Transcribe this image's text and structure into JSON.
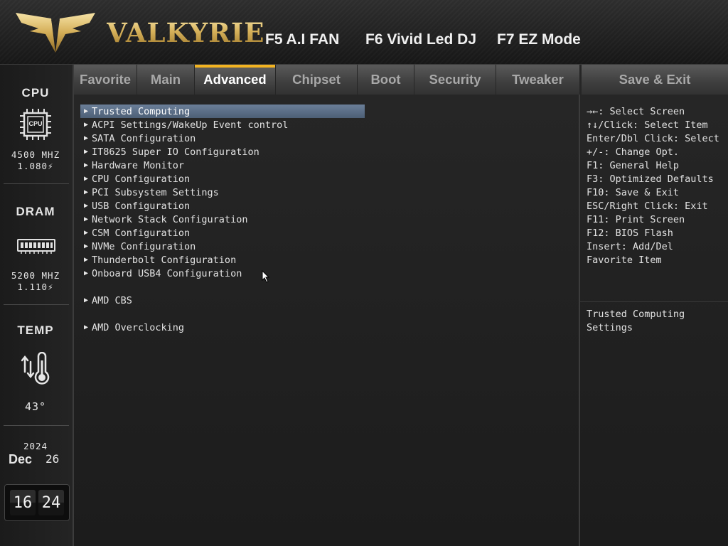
{
  "header": {
    "brand": "VALKYRIE",
    "hotkeys": {
      "fan": "F5 A.I FAN",
      "led": "F6 Vivid Led DJ",
      "ez": "F7 EZ Mode"
    }
  },
  "sidebar": {
    "cpu": {
      "label": "CPU",
      "chip_text": "CPU",
      "freq": "4500 MHZ",
      "volt": "1.080⚡"
    },
    "dram": {
      "label": "DRAM",
      "freq": "5200 MHZ",
      "volt": "1.110⚡"
    },
    "temp": {
      "label": "TEMP",
      "value": "43°"
    },
    "date": {
      "year": "2024",
      "month": "Dec",
      "day": "26"
    },
    "clock": {
      "hours": "16",
      "minutes": "24"
    }
  },
  "tabs": {
    "favorite": "Favorite",
    "main": "Main",
    "advanced": "Advanced",
    "chipset": "Chipset",
    "boot": "Boot",
    "security": "Security",
    "tweaker": "Tweaker",
    "save_exit": "Save & Exit",
    "active": "Advanced"
  },
  "menu": {
    "items": [
      "Trusted Computing",
      "ACPI Settings/WakeUp Event control",
      "SATA Configuration",
      "IT8625 Super IO Configuration",
      "Hardware Monitor",
      "CPU Configuration",
      "PCI Subsystem Settings",
      "USB Configuration",
      "Network Stack Configuration",
      "CSM Configuration",
      "NVMe Configuration",
      "Thunderbolt Configuration",
      "Onboard USB4 Configuration",
      "AMD CBS",
      "AMD Overclocking"
    ],
    "selected": "Trusted Computing"
  },
  "help": {
    "keys": [
      "→←: Select Screen",
      "↑↓/Click: Select Item",
      "Enter/Dbl Click: Select",
      "+/-: Change Opt.",
      "F1: General Help",
      "F3: Optimized Defaults",
      "F10: Save & Exit",
      "ESC/Right Click: Exit",
      "F11: Print Screen",
      "F12: BIOS Flash",
      "Insert: Add/Del",
      "Favorite Item"
    ],
    "description": [
      "Trusted Computing",
      "Settings"
    ]
  },
  "colors": {
    "accent_tab": "#f2b321",
    "selected_row": "#5b6e87",
    "brand_gold": "#d7b25b"
  }
}
